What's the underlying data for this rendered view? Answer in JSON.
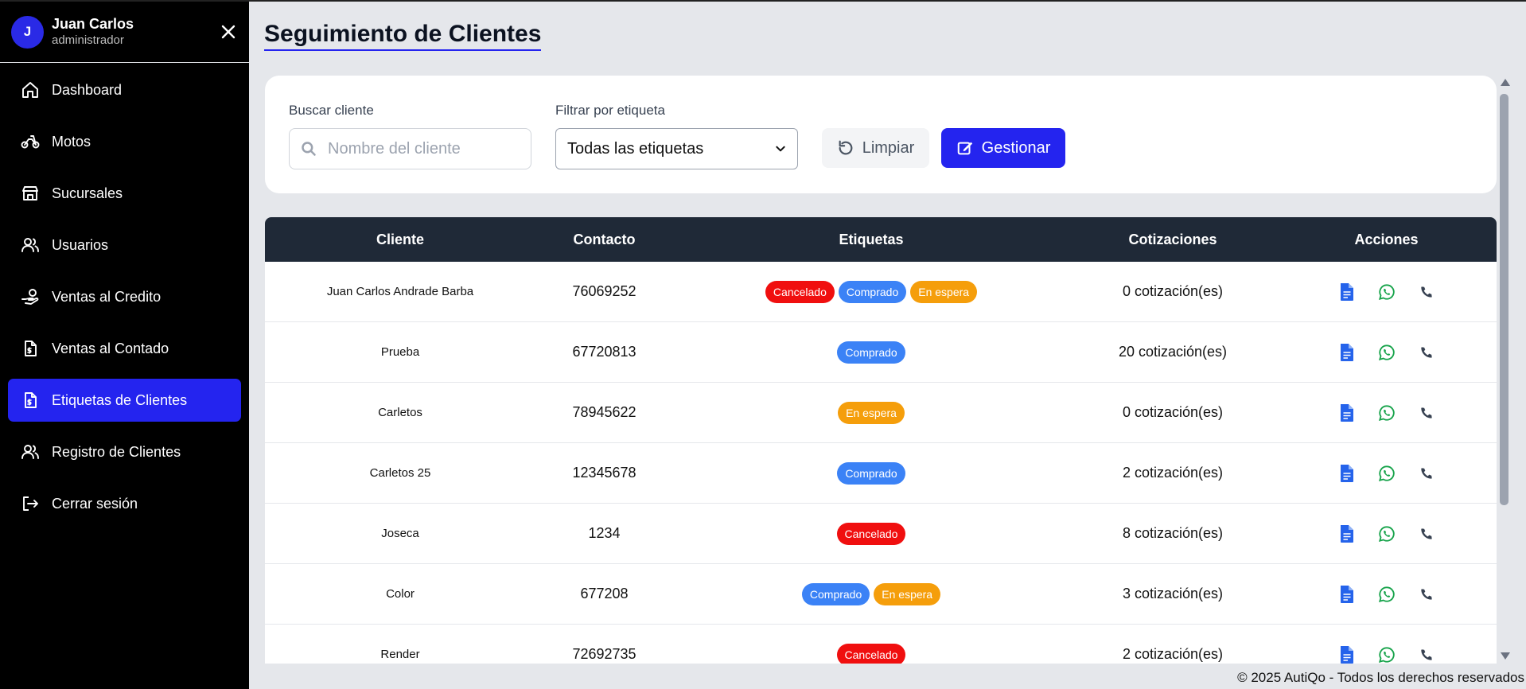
{
  "user": {
    "initial": "J",
    "name": "Juan Carlos",
    "role": "administrador"
  },
  "sidebar": {
    "items": [
      {
        "label": "Dashboard",
        "icon": "home-icon"
      },
      {
        "label": "Motos",
        "icon": "bike-icon"
      },
      {
        "label": "Sucursales",
        "icon": "store-icon"
      },
      {
        "label": "Usuarios",
        "icon": "users-icon"
      },
      {
        "label": "Ventas al Credito",
        "icon": "hand-coins-icon"
      },
      {
        "label": "Ventas al Contado",
        "icon": "file-dollar-icon"
      },
      {
        "label": "Etiquetas de Clientes",
        "icon": "file-dollar-icon",
        "active": true
      },
      {
        "label": "Registro de Clientes",
        "icon": "users-icon"
      },
      {
        "label": "Cerrar sesión",
        "icon": "logout-icon"
      }
    ]
  },
  "page": {
    "title": "Seguimiento de Clientes"
  },
  "filters": {
    "search_label": "Buscar cliente",
    "search_placeholder": "Nombre del cliente",
    "tag_label": "Filtrar por etiqueta",
    "tag_selected": "Todas las etiquetas",
    "clear_label": "Limpiar",
    "manage_label": "Gestionar"
  },
  "table": {
    "headers": {
      "client": "Cliente",
      "contact": "Contacto",
      "tags": "Etiquetas",
      "quotes": "Cotizaciones",
      "actions": "Acciones"
    },
    "rows": [
      {
        "name": "Juan Carlos Andrade Barba",
        "contact": "76069252",
        "tags": [
          "Cancelado",
          "Comprado",
          "En espera"
        ],
        "quotes": "0 cotización(es)"
      },
      {
        "name": "Prueba",
        "contact": "67720813",
        "tags": [
          "Comprado"
        ],
        "quotes": "20 cotización(es)"
      },
      {
        "name": "Carletos",
        "contact": "78945622",
        "tags": [
          "En espera"
        ],
        "quotes": "0 cotización(es)"
      },
      {
        "name": "Carletos 25",
        "contact": "12345678",
        "tags": [
          "Comprado"
        ],
        "quotes": "2 cotización(es)"
      },
      {
        "name": "Joseca",
        "contact": "1234",
        "tags": [
          "Cancelado"
        ],
        "quotes": "8 cotización(es)"
      },
      {
        "name": "Color",
        "contact": "677208",
        "tags": [
          "Comprado",
          "En espera"
        ],
        "quotes": "3 cotización(es)"
      },
      {
        "name": "Render",
        "contact": "72692735",
        "tags": [
          "Cancelado"
        ],
        "quotes": "2 cotización(es)"
      }
    ]
  },
  "tag_colors": {
    "Cancelado": "#f00f0f",
    "Comprado": "#3b82f6",
    "En espera": "#f59e0b"
  },
  "colors": {
    "accent": "#2424ef",
    "header_bg": "#1f2937",
    "doc_icon": "#2563eb",
    "whatsapp": "#16a34a",
    "phone": "#374151"
  },
  "footer": {
    "text": "© 2025 AutiQo - Todos los derechos reservados"
  }
}
